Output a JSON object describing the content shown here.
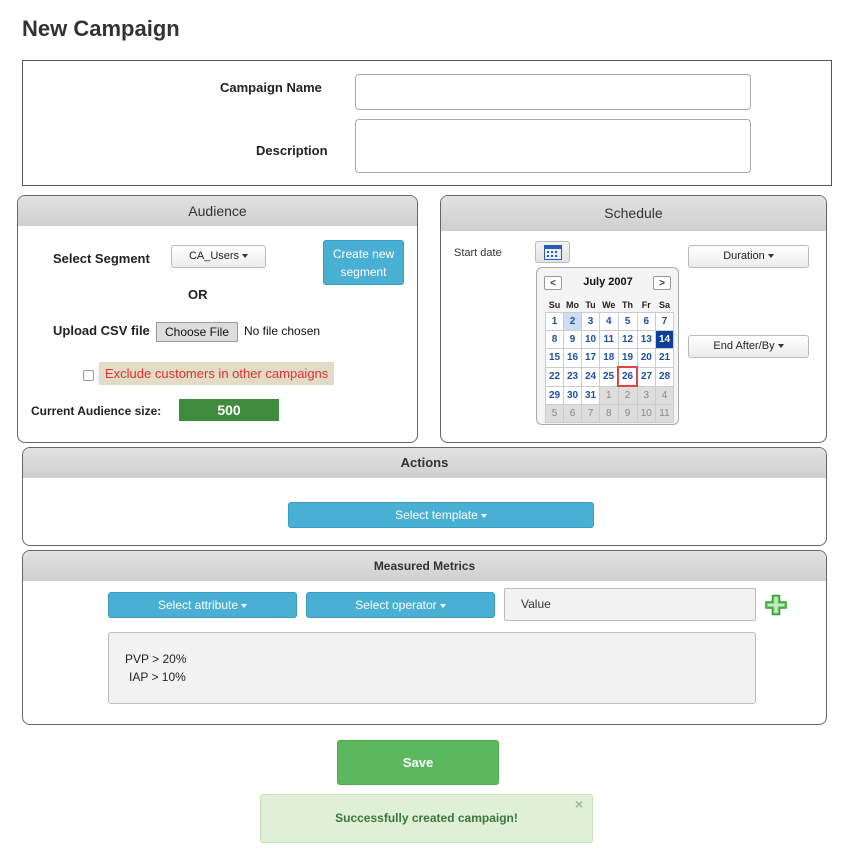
{
  "page": {
    "title": "New Campaign"
  },
  "basics": {
    "campaign_name_label": "Campaign Name",
    "campaign_name_value": "",
    "description_label": "Description",
    "description_value": ""
  },
  "audience": {
    "header": "Audience",
    "select_segment_label": "Select Segment",
    "segment_dropdown": "CA_Users",
    "create_segment_button": "Create new segment",
    "or_label": "OR",
    "upload_csv_label": "Upload CSV file",
    "choose_file_button": "Choose File",
    "no_file_text": "No file chosen",
    "exclude_label": "Exclude customers in other campaigns",
    "exclude_checked": false,
    "current_size_label": "Current Audience size:",
    "current_size_value": "500"
  },
  "schedule": {
    "header": "Schedule",
    "start_date_label": "Start date",
    "duration_dropdown": "Duration",
    "end_after_dropdown": "End After/By",
    "calendar": {
      "month_label": "July 2007",
      "prev": "<",
      "next": ">",
      "weekdays": [
        "Su",
        "Mo",
        "Tu",
        "We",
        "Th",
        "Fr",
        "Sa"
      ],
      "weeks": [
        [
          "1",
          "2",
          "3",
          "4",
          "5",
          "6",
          "7"
        ],
        [
          "8",
          "9",
          "10",
          "11",
          "12",
          "13",
          "14"
        ],
        [
          "15",
          "16",
          "17",
          "18",
          "19",
          "20",
          "21"
        ],
        [
          "22",
          "23",
          "24",
          "25",
          "26",
          "27",
          "28"
        ],
        [
          "29",
          "30",
          "31",
          "1",
          "2",
          "3",
          "4"
        ],
        [
          "5",
          "6",
          "7",
          "8",
          "9",
          "10",
          "11"
        ]
      ]
    }
  },
  "actions": {
    "header": "Actions",
    "select_template_button": "Select template"
  },
  "metrics": {
    "header": "Measured Metrics",
    "select_attribute_button": "Select attribute",
    "select_operator_button": "Select operator",
    "value_placeholder": "Value",
    "rules": [
      "PVP > 20%",
      "IAP > 10%"
    ]
  },
  "footer": {
    "save_button": "Save",
    "success_message": "Successfully created campaign!",
    "close_symbol": "×"
  },
  "colors": {
    "accent_blue": "#4ab0d3",
    "save_green": "#5cb85c",
    "audience_badge": "#3f8c3f",
    "calendar_selected": "#0d3e9a",
    "exclude_text": "#e03030",
    "add_icon": "#5cb85c"
  },
  "icons": {
    "calendar_trigger": "calendar-icon",
    "add_metric": "plus-icon",
    "dropdown": "caret-down-icon",
    "close": "close-icon"
  }
}
